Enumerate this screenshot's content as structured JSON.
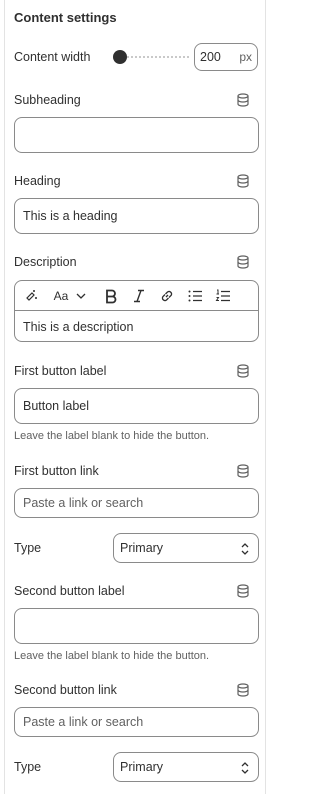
{
  "section": {
    "title": "Content settings"
  },
  "content_width": {
    "label": "Content width",
    "value": "200",
    "unit": "px",
    "slider_level": 0
  },
  "subheading": {
    "label": "Subheading",
    "value": ""
  },
  "heading": {
    "label": "Heading",
    "value": "This is a heading"
  },
  "description": {
    "label": "Description",
    "value": "This is a description",
    "toolbar": {
      "font_style": "Aa"
    }
  },
  "first_button_label": {
    "label": "First button label",
    "value": "Button label",
    "help": "Leave the label blank to hide the button."
  },
  "first_button_link": {
    "label": "First button link",
    "placeholder": "Paste a link or search"
  },
  "first_type": {
    "label": "Type",
    "selected": "Primary"
  },
  "second_button_label": {
    "label": "Second button label",
    "value": "",
    "help": "Leave the label blank to hide the button."
  },
  "second_button_link": {
    "label": "Second button link",
    "placeholder": "Paste a link or search"
  },
  "second_type": {
    "label": "Type",
    "selected": "Primary"
  },
  "icons": {
    "dynamic_source": "database-icon",
    "select": "chevron-up-down-icon"
  },
  "colors": {
    "border": "#8a8a8a",
    "text": "#303030",
    "muted": "#616161"
  }
}
